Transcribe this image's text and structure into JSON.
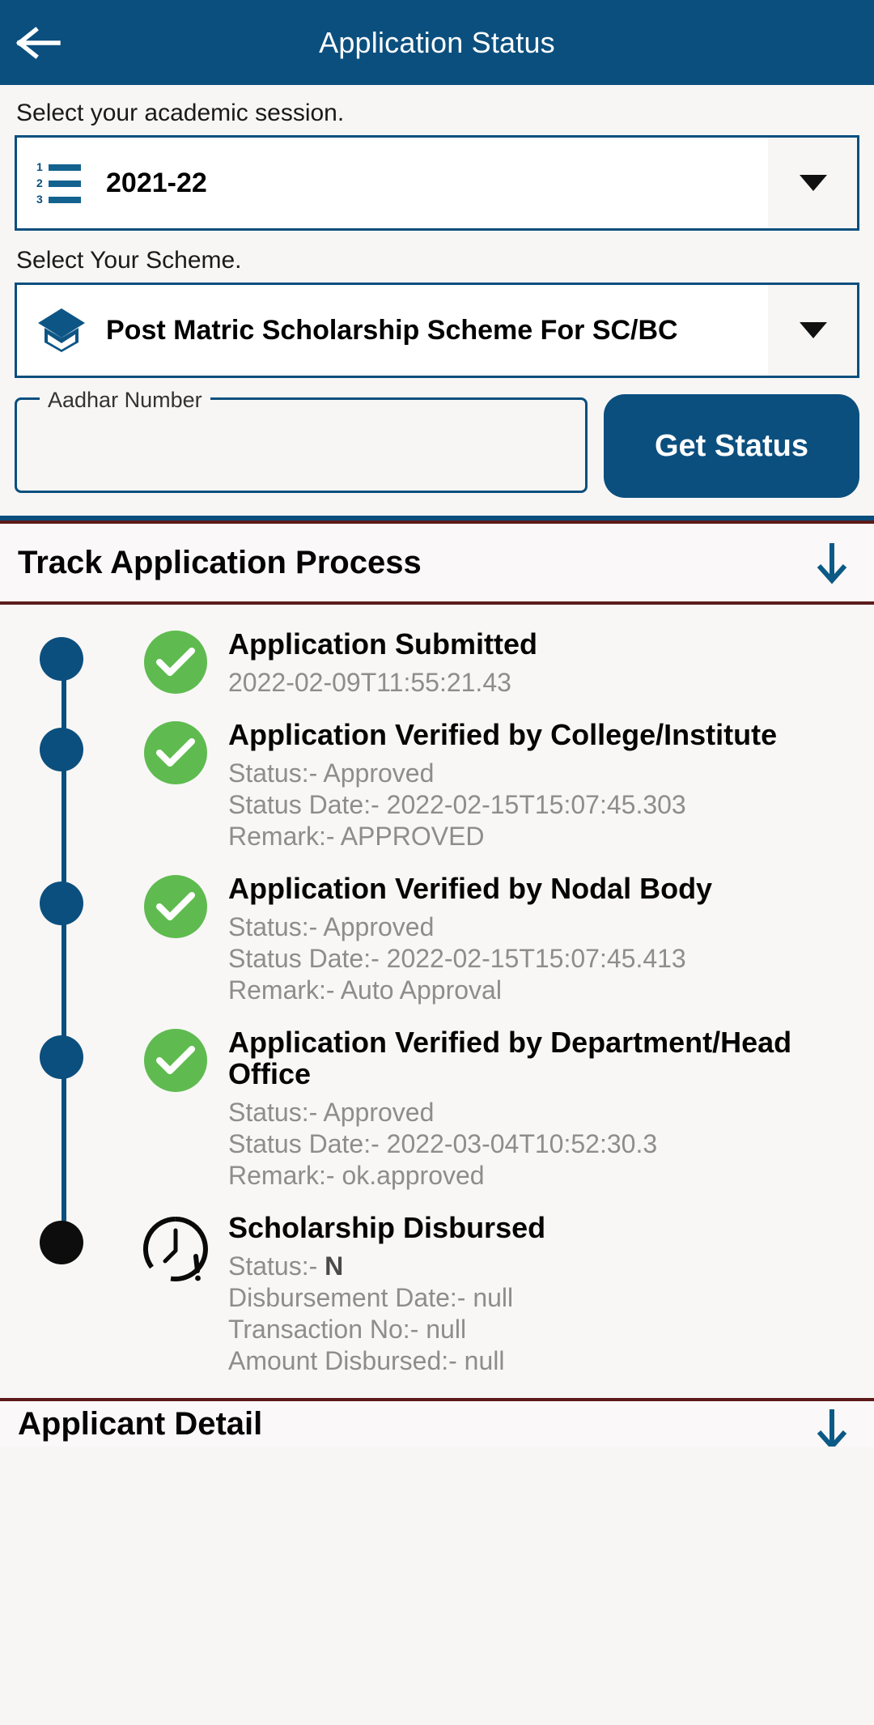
{
  "appbar": {
    "back_icon": "arrow-left-icon",
    "title": "Application Status"
  },
  "form": {
    "session": {
      "label": "Select your academic session.",
      "icon": "numbered-list-icon",
      "value": "2021-22",
      "caret_icon": "chevron-down-icon"
    },
    "scheme": {
      "label": "Select Your  Scheme.",
      "icon": "graduation-cap-icon",
      "value": "Post Matric Scholarship Scheme For SC/BC",
      "caret_icon": "chevron-down-icon"
    },
    "aadhar": {
      "label": "Aadhar Number",
      "value": "",
      "placeholder": ""
    },
    "submit_label": "Get Status"
  },
  "track_section": {
    "title": "Track Application Process",
    "toggle_icon": "arrow-down-icon"
  },
  "timeline": [
    {
      "icon": "check-circle-icon",
      "state": "done",
      "title": "Application Submitted",
      "lines": [
        {
          "text": "2022-02-09T11:55:21.43"
        }
      ]
    },
    {
      "icon": "check-circle-icon",
      "state": "done",
      "title": "Application Verified by College/Institute",
      "lines": [
        {
          "text": "Status:- Approved"
        },
        {
          "text": "Status Date:- 2022-02-15T15:07:45.303"
        },
        {
          "text": "Remark:- APPROVED"
        }
      ]
    },
    {
      "icon": "check-circle-icon",
      "state": "done",
      "title": "Application Verified by Nodal Body",
      "lines": [
        {
          "text": "Status:- Approved"
        },
        {
          "text": "Status Date:- 2022-02-15T15:07:45.413"
        },
        {
          "text": "Remark:- Auto Approval"
        }
      ]
    },
    {
      "icon": "check-circle-icon",
      "state": "done",
      "title": "Application Verified by Department/Head Office",
      "lines": [
        {
          "text": "Status:- Approved"
        },
        {
          "text": "Status Date:- 2022-03-04T10:52:30.3"
        },
        {
          "text": "Remark:- ok.approved"
        }
      ]
    },
    {
      "icon": "clock-alert-icon",
      "state": "pending",
      "title": "Scholarship Disbursed",
      "lines": [
        {
          "text": "Status:- ",
          "strong": "N"
        },
        {
          "text": "Disbursement Date:- null"
        },
        {
          "text": "Transaction No:- null"
        },
        {
          "text": "Amount Disbursed:- null"
        }
      ]
    }
  ],
  "applicant_section": {
    "title": "Applicant Detail",
    "toggle_icon": "arrow-down-icon"
  },
  "colors": {
    "brand_blue": "#0b4f7e",
    "success_green": "#5fbb4f",
    "section_border": "#5c1a1a",
    "pending_dot": "#0d0d0d",
    "muted_text": "#8d8d8d",
    "page_bg": "#f7f6f5"
  }
}
